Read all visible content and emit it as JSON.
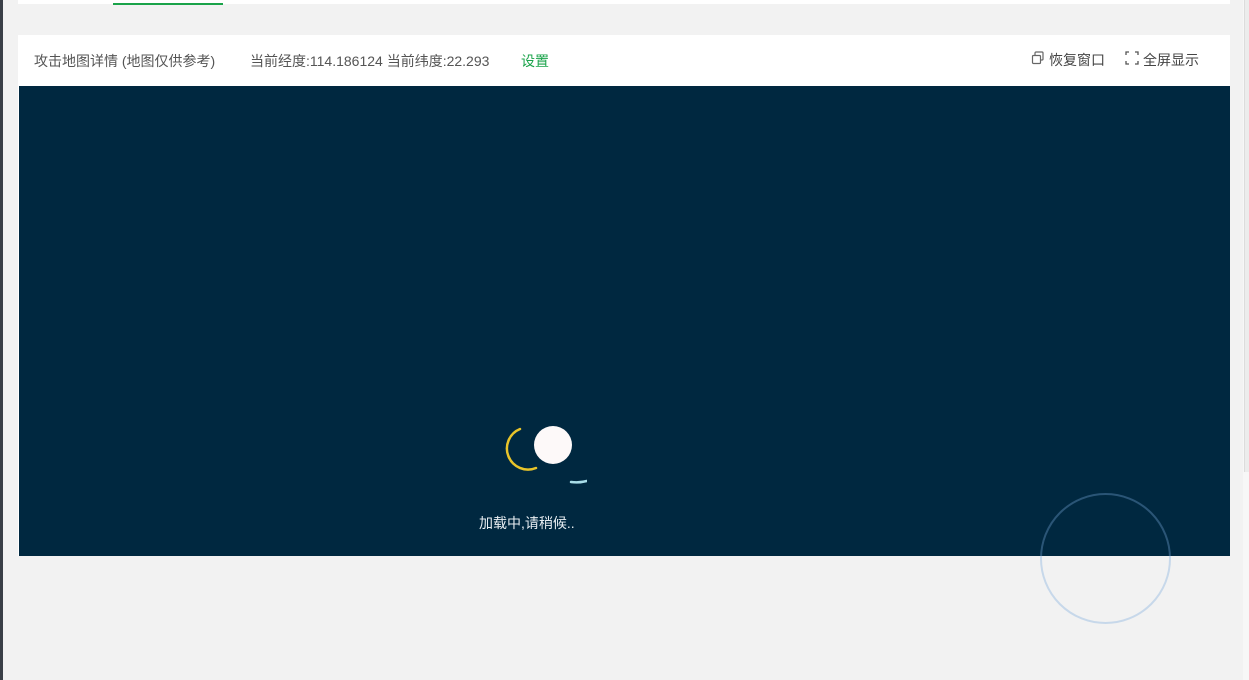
{
  "panel": {
    "title": "攻击地图详情 (地图仅供参考)",
    "coords": "当前经度:114.186124 当前纬度:22.293",
    "settings_label": "设置",
    "restore_label": "恢复窗口",
    "fullscreen_label": "全屏显示"
  },
  "map": {
    "loading_text": "加载中,请稍候..",
    "background_color": "#002840"
  },
  "colors": {
    "accent": "#1aa34a",
    "spinner_yellow": "#e8c42a",
    "spinner_cyan": "#a8dde8",
    "spinner_dot": "#fdf9f9"
  },
  "icons": {
    "restore": "restore-window-icon",
    "fullscreen": "fullscreen-icon"
  }
}
